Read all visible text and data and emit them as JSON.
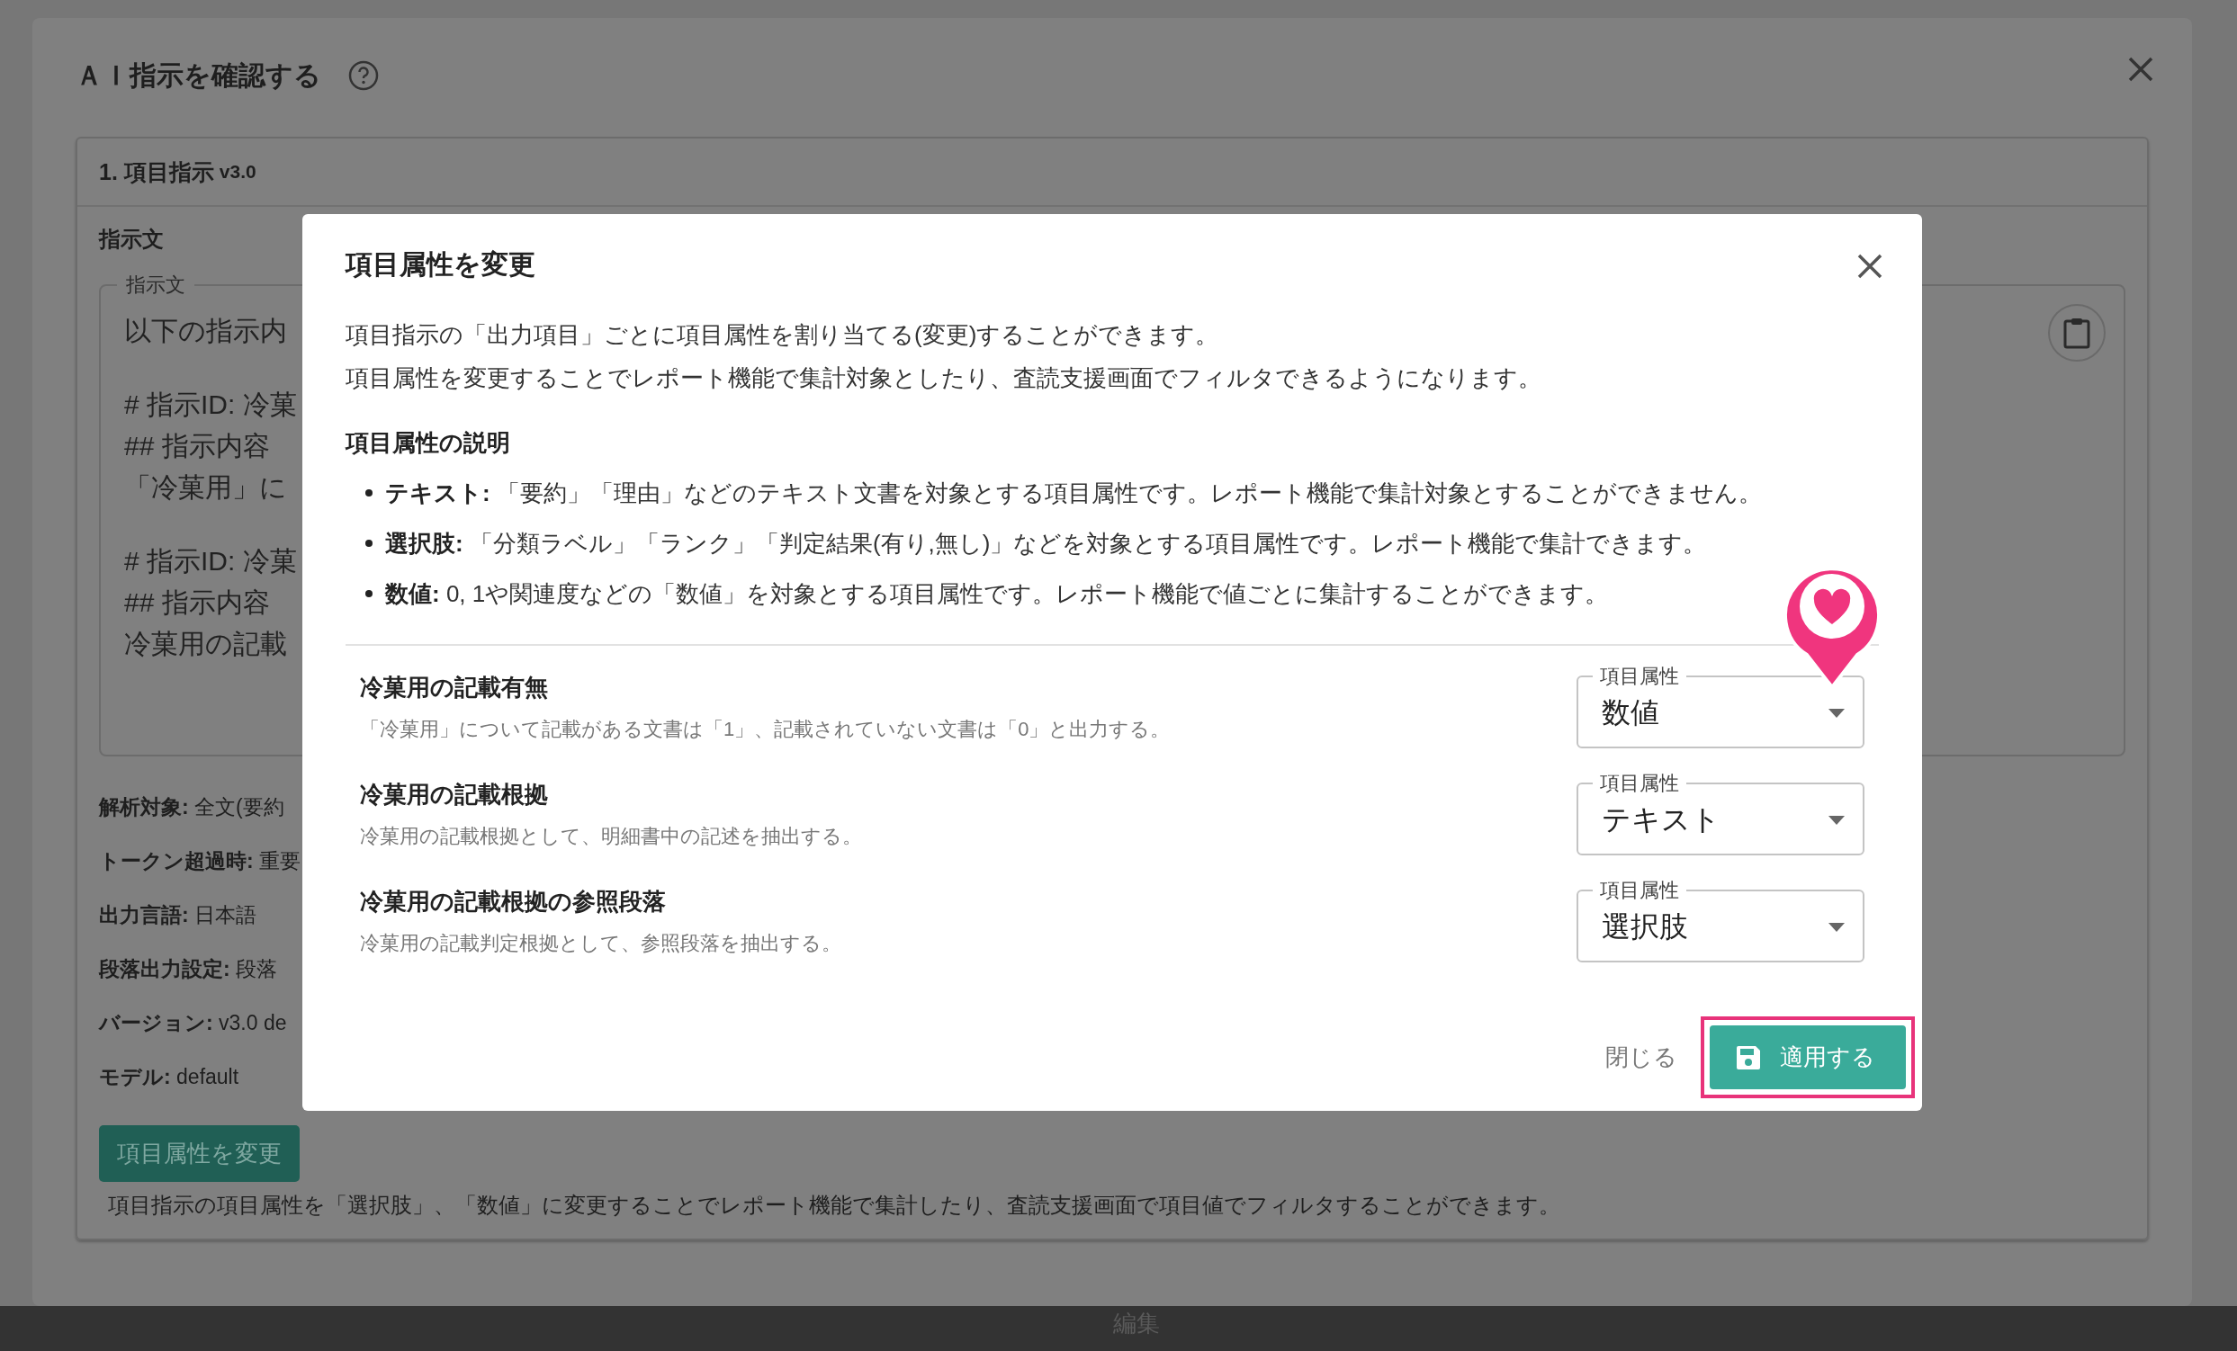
{
  "background_page": {
    "label": "編集"
  },
  "dialog": {
    "title": "ＡＩ指示を確認する",
    "section": {
      "heading": "1. 項目指示",
      "version": "v3.0",
      "instruction_label": "指示文",
      "instruction_field": {
        "legend": "指示文",
        "paragraphs": [
          [
            "以下の指示内"
          ],
          [
            "# 指示ID: 冷菓",
            "## 指示内容",
            "「冷菓用」に"
          ],
          [
            "# 指示ID: 冷菓",
            "## 指示内容",
            "冷菓用の記載"
          ]
        ]
      },
      "details": [
        {
          "label": "解析対象:",
          "value": "全文(要約"
        },
        {
          "label": "トークン超過時:",
          "value": "重要"
        },
        {
          "label": "出力言語:",
          "value": "日本語"
        },
        {
          "label": "段落出力設定:",
          "value": "段落"
        },
        {
          "label": "バージョン:",
          "value": "v3.0 de"
        },
        {
          "label": "モデル:",
          "value": "default"
        }
      ],
      "button": "項目属性を変更",
      "note": "項目指示の項目属性を「選択肢」、「数値」に変更することでレポート機能で集計したり、査読支援画面で項目値でフィルタすることができます。"
    }
  },
  "modal": {
    "title": "項目属性を変更",
    "description": [
      "項目指示の「出力項目」ごとに項目属性を割り当てる(変更)することができます。",
      "項目属性を変更することでレポート機能で集計対象としたり、査読支援画面でフィルタできるようになります。"
    ],
    "explanation_heading": "項目属性の説明",
    "explanation_items": [
      {
        "term": "テキスト:",
        "text": "「要約」「理由」などのテキスト文書を対象とする項目属性です。レポート機能で集計対象とすることができません。"
      },
      {
        "term": "選択肢:",
        "text": "「分類ラベル」「ランク」「判定結果(有り,無し)」などを対象とする項目属性です。レポート機能で集計できます。"
      },
      {
        "term": "数値:",
        "text": "0, 1や関連度などの「数値」を対象とする項目属性です。レポート機能で値ごとに集計することができます。"
      }
    ],
    "items": [
      {
        "name": "冷菓用の記載有無",
        "description": "「冷菓用」について記載がある文書は「1」、記載されていない文書は「0」と出力する。",
        "select_label": "項目属性",
        "value": "数値"
      },
      {
        "name": "冷菓用の記載根拠",
        "description": "冷菓用の記載根拠として、明細書中の記述を抽出する。",
        "select_label": "項目属性",
        "value": "テキスト"
      },
      {
        "name": "冷菓用の記載根拠の参照段落",
        "description": "冷菓用の記載判定根拠として、参照段落を抽出する。",
        "select_label": "項目属性",
        "value": "選択肢"
      }
    ],
    "close_button": "閉じる",
    "apply_button": "適用する",
    "apply_highlighted": true
  }
}
